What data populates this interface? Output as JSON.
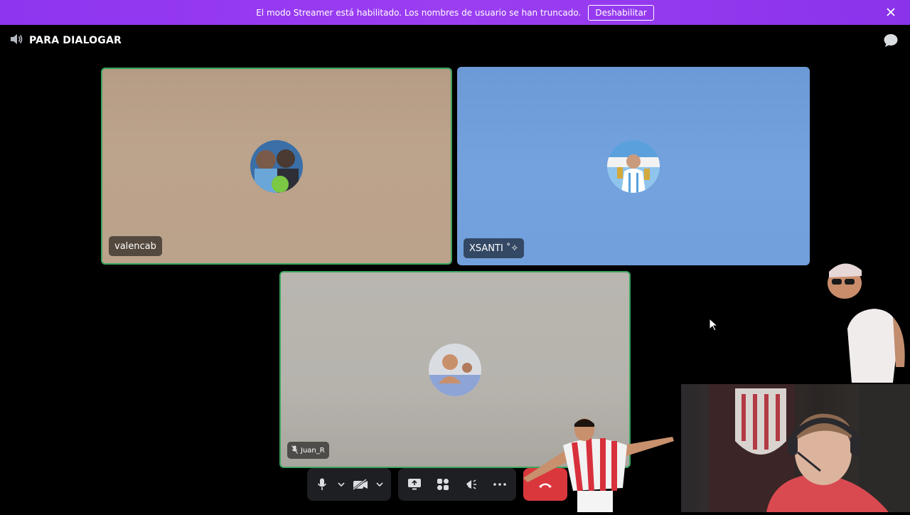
{
  "banner": {
    "message": "El modo Streamer está habilitado. Los nombres de usuario se han truncado.",
    "button_label": "Deshabilitar",
    "background": "#8e35ef"
  },
  "header": {
    "channel_name": "PARA DIALOGAR",
    "channel_icon": "speaker-icon",
    "chat_icon": "chat-bubble-icon"
  },
  "participants": [
    {
      "name": "valencab",
      "speaking": true,
      "tile_color": "#bba28b"
    },
    {
      "name": "XSANTI ˚✧",
      "speaking": false,
      "tile_color": "#72a0dc"
    },
    {
      "name": "Juan_R",
      "speaking": true,
      "tile_color": "#b6b3ad",
      "muted": true
    }
  ],
  "controls": {
    "microphone": "microphone-icon",
    "camera": "camera-off-icon",
    "screen_share": "screen-share-icon",
    "activities": "activities-icon",
    "soundboard": "soundboard-icon",
    "more": "more-icon",
    "disconnect": "disconnect-icon",
    "disconnect_color": "#da373c"
  },
  "colors": {
    "speaking_border": "#3ba55d",
    "control_bg": "#1e1f22"
  }
}
